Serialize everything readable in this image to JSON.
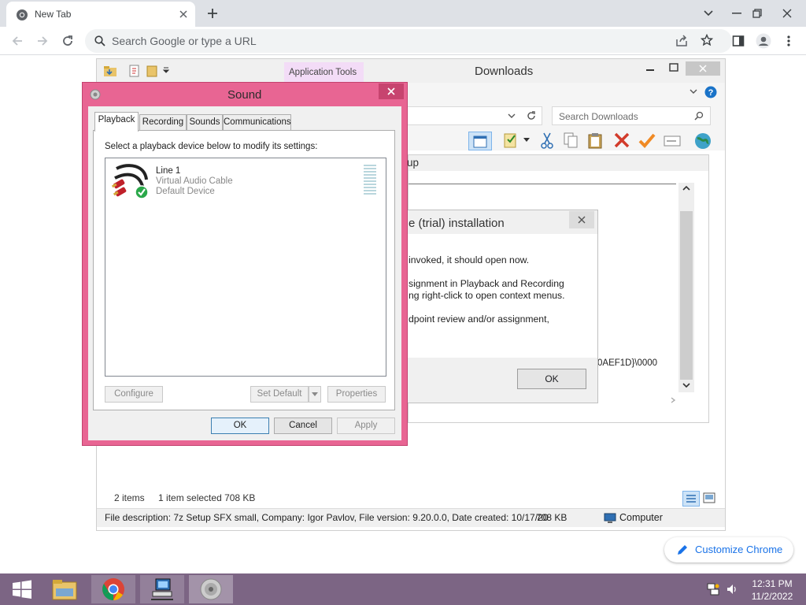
{
  "browser": {
    "tab_title": "New Tab",
    "omnibox_placeholder": "Search Google or type a URL",
    "customize_label": "Customize Chrome"
  },
  "explorer": {
    "title": "Downloads",
    "ribbon_context_tab": "Application Tools",
    "search_placeholder": "Search Downloads",
    "status_items": "2 items",
    "status_selected": "1 item selected  708 KB",
    "file_description": "File description: 7z Setup SFX small, Company: Igor Pavlov, File version: 9.20.0.0, Date created: 10/17/20",
    "file_size": "708 KB",
    "location": "Computer"
  },
  "setup_window": {
    "title_fragment": "up",
    "error_fragment": "0AEF1D}\\0000"
  },
  "message_box": {
    "title_fragment": "e (trial) installation",
    "line1": "invoked, it should open now.",
    "line2": "signment in Playback and Recording",
    "line3": "ng right-click to open context menus.",
    "line4": "dpoint review and/or assignment,",
    "ok_label": "OK"
  },
  "sound_dialog": {
    "title": "Sound",
    "tabs": [
      "Playback",
      "Recording",
      "Sounds",
      "Communications"
    ],
    "instruction": "Select a playback device below to modify its settings:",
    "devices": [
      {
        "name": "Line 1",
        "description": "Virtual Audio Cable",
        "status": "Default Device"
      }
    ],
    "configure_label": "Configure",
    "set_default_label": "Set Default",
    "properties_label": "Properties",
    "ok_label": "OK",
    "cancel_label": "Cancel",
    "apply_label": "Apply"
  },
  "taskbar": {
    "time": "12:31 PM",
    "date": "11/2/2022"
  }
}
